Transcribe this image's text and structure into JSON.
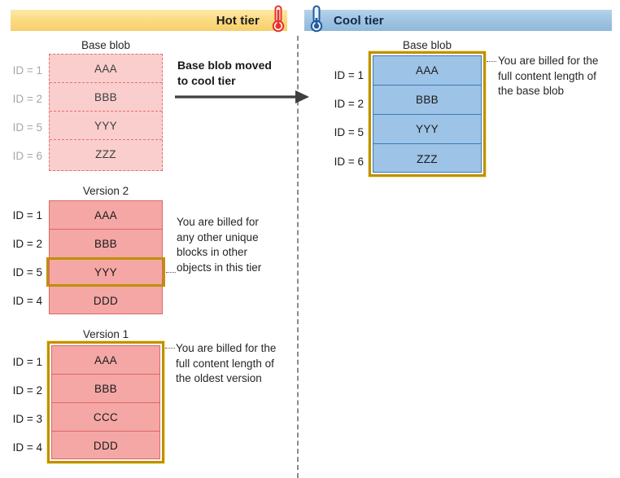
{
  "tiers": {
    "hot": {
      "label": "Hot tier",
      "icon": "thermometer-hot-icon",
      "accent": "#f6cf6b"
    },
    "cool": {
      "label": "Cool tier",
      "icon": "thermometer-cool-icon",
      "accent": "#9fc4e2"
    }
  },
  "transition": {
    "label_line1": "Base blob moved",
    "label_line2": "to cool tier",
    "arrow": "right-arrow-icon"
  },
  "hot_tier": {
    "base_blob": {
      "title": "Base blob",
      "state": "moved-away",
      "rows": [
        {
          "id": "ID = 1",
          "block": "AAA"
        },
        {
          "id": "ID = 2",
          "block": "BBB"
        },
        {
          "id": "ID = 5",
          "block": "YYY"
        },
        {
          "id": "ID = 6",
          "block": "ZZZ"
        }
      ]
    },
    "version2": {
      "title": "Version 2",
      "rows": [
        {
          "id": "ID = 1",
          "block": "AAA"
        },
        {
          "id": "ID = 2",
          "block": "BBB"
        },
        {
          "id": "ID = 5",
          "block": "YYY"
        },
        {
          "id": "ID = 4",
          "block": "DDD"
        }
      ],
      "highlighted_row_index": 2,
      "annotation": "You are billed for any other unique blocks in other objects in this tier"
    },
    "version1": {
      "title": "Version 1",
      "rows": [
        {
          "id": "ID = 1",
          "block": "AAA"
        },
        {
          "id": "ID = 2",
          "block": "BBB"
        },
        {
          "id": "ID = 3",
          "block": "CCC"
        },
        {
          "id": "ID = 4",
          "block": "DDD"
        }
      ],
      "highlighted": "all",
      "annotation": "You are billed for the full content length of the oldest version"
    }
  },
  "cool_tier": {
    "base_blob": {
      "title": "Base blob",
      "rows": [
        {
          "id": "ID = 1",
          "block": "AAA"
        },
        {
          "id": "ID = 2",
          "block": "BBB"
        },
        {
          "id": "ID = 5",
          "block": "YYY"
        },
        {
          "id": "ID = 6",
          "block": "ZZZ"
        }
      ],
      "highlighted": "all",
      "annotation": "You are billed for the full content length of the base blob"
    }
  },
  "annotations": {
    "cool_base_l1": "You are billed for the",
    "cool_base_l2": "full content length of",
    "cool_base_l3": "the base blob",
    "v2_l1": "You are billed for",
    "v2_l2": "any other unique",
    "v2_l3": "blocks in other",
    "v2_l4": "objects in this tier",
    "v1_l1": "You are billed for the",
    "v1_l2": "full content length of",
    "v1_l3": "the oldest version"
  },
  "colors": {
    "hot_fill": "#f4a7a5",
    "hot_faded_fill": "#f9cecd",
    "cool_fill": "#9dc3e6",
    "highlight": "#bf9000",
    "divider": "#8c8c8c"
  }
}
